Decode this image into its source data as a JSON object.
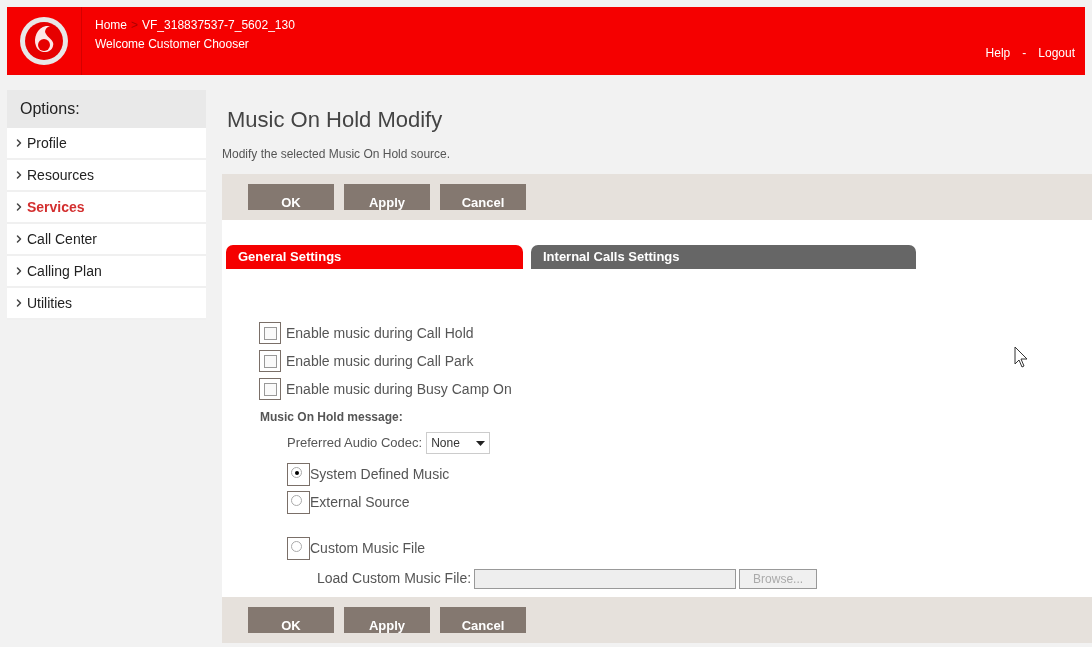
{
  "header": {
    "breadcrumb": {
      "home": "Home",
      "separator": ">",
      "current": "VF_318837537-7_5602_130"
    },
    "welcome": "Welcome Customer Chooser",
    "links": [
      "Help",
      "Logout"
    ],
    "link_separator": "-"
  },
  "sidebar": {
    "title": "Options:",
    "items": [
      {
        "label": "Profile",
        "selected": false
      },
      {
        "label": "Resources",
        "selected": false
      },
      {
        "label": "Services",
        "selected": true
      },
      {
        "label": "Call Center",
        "selected": false
      },
      {
        "label": "Calling Plan",
        "selected": false
      },
      {
        "label": "Utilities",
        "selected": false
      }
    ]
  },
  "page": {
    "title": "Music On Hold Modify",
    "description": "Modify the selected Music On Hold source."
  },
  "buttons": [
    "OK",
    "Apply",
    "Cancel"
  ],
  "tabs": [
    {
      "label": "General Settings",
      "selected": true
    },
    {
      "label": "Internal Calls Settings",
      "selected": false
    }
  ],
  "checkboxes": [
    {
      "label": "Enable music during Call Hold",
      "checked": false
    },
    {
      "label": "Enable music during Call Park",
      "checked": false
    },
    {
      "label": "Enable music during Busy Camp On",
      "checked": false
    }
  ],
  "message_section": {
    "title": "Music On Hold message:",
    "codec_label": "Preferred Audio Codec:",
    "codec_value": "None",
    "sources": [
      {
        "label": "System Defined Music",
        "selected": true
      },
      {
        "label": "External Source",
        "selected": false
      },
      {
        "label": "Custom Music File",
        "selected": false
      }
    ],
    "file_label": "Load Custom Music File:",
    "browse": "Browse..."
  },
  "bottom_buttons": [
    "OK",
    "Apply",
    "Cancel"
  ]
}
